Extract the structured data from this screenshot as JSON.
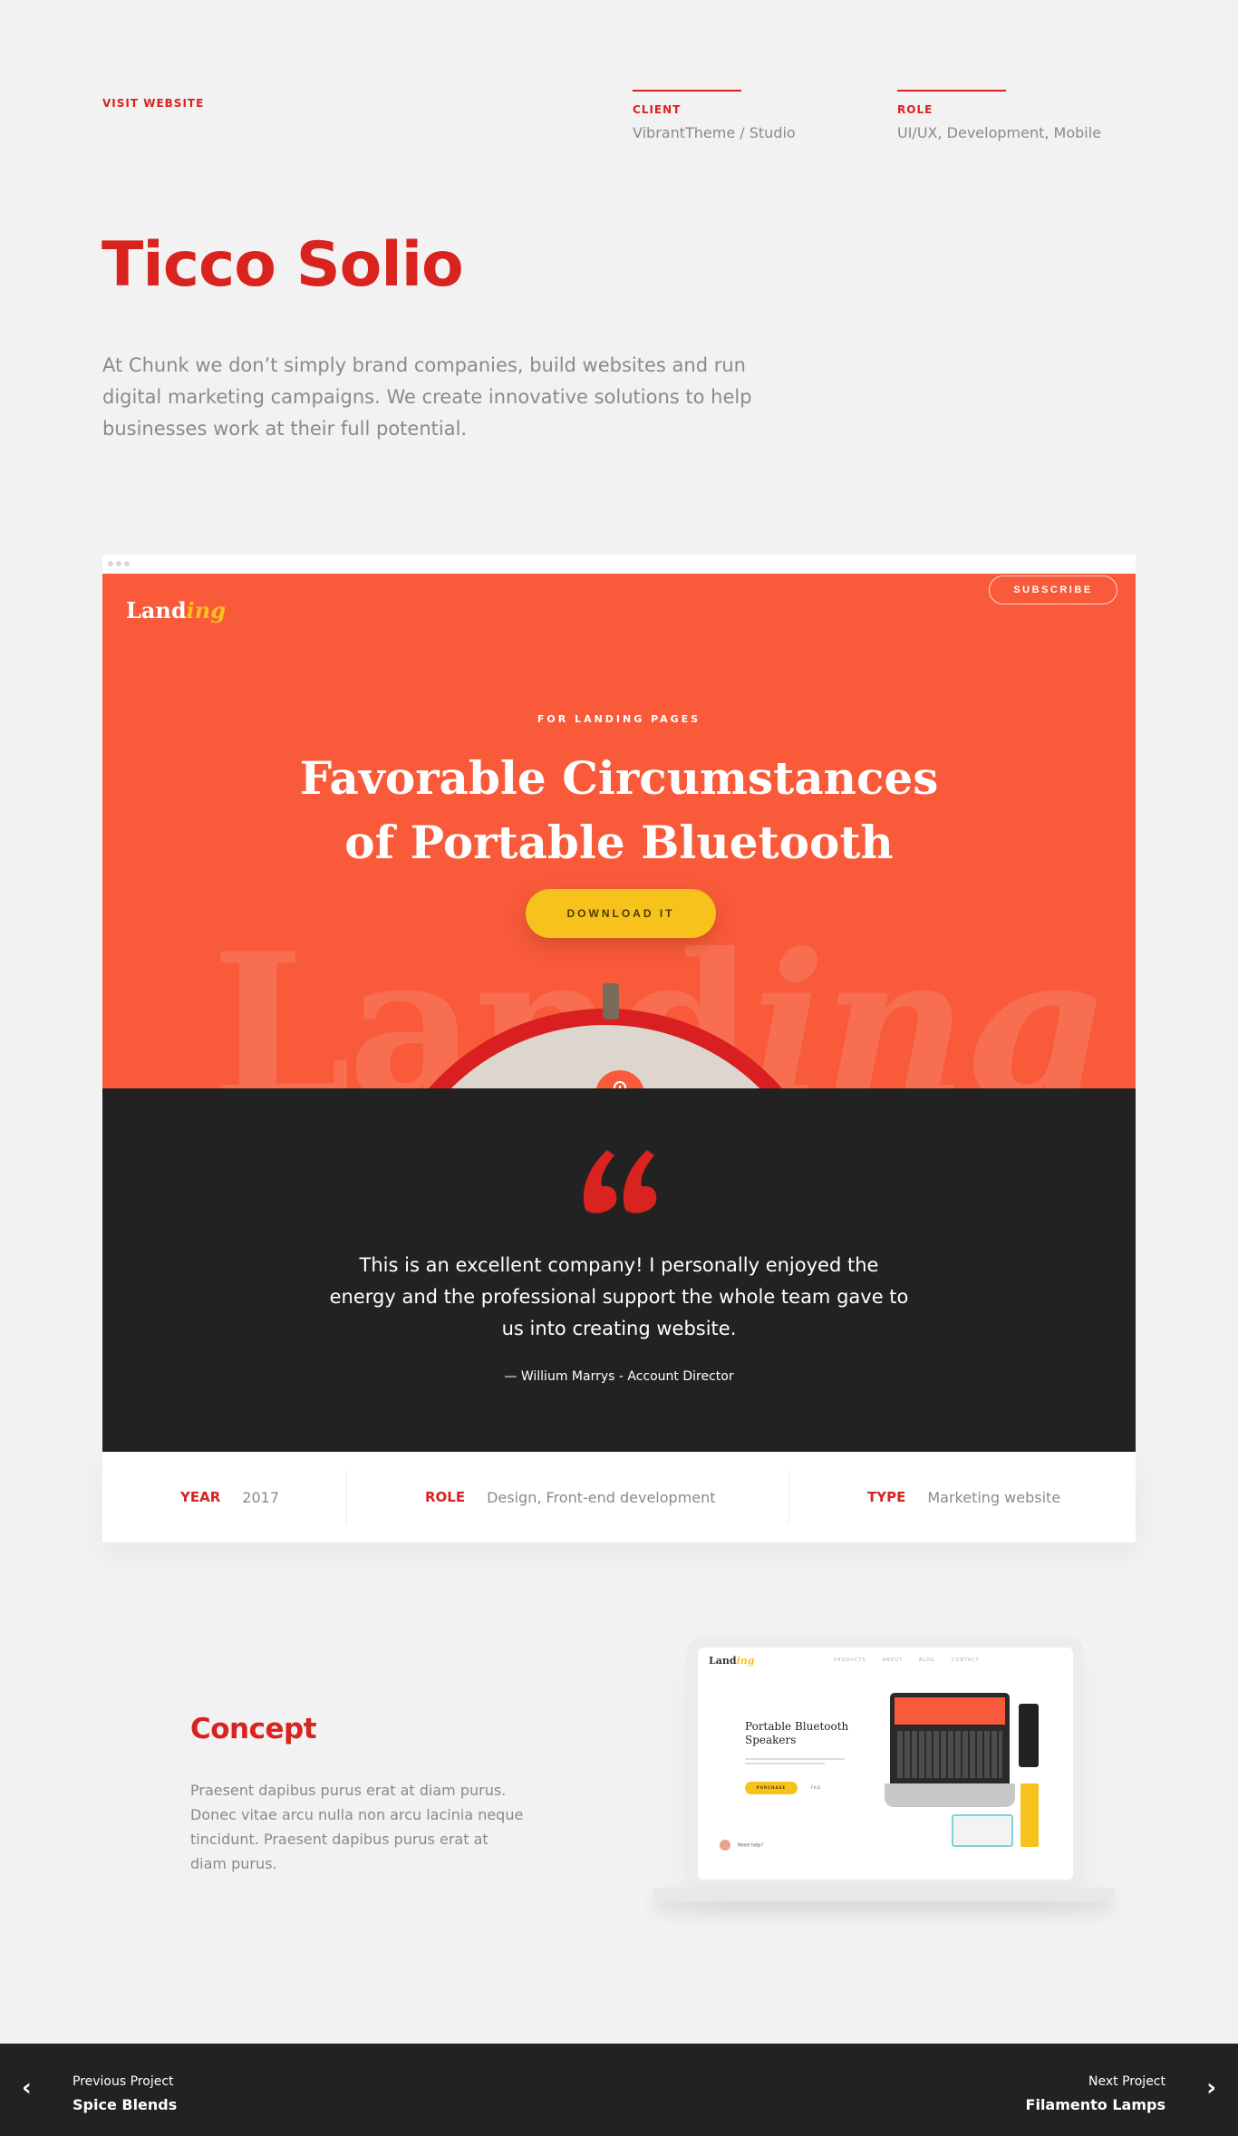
{
  "header": {
    "visit_label": "VISIT WEBSITE",
    "client_label": "CLIENT",
    "client_value": "VibrantTheme / Studio",
    "role_label": "ROLE",
    "role_value": "UI/UX, Development, Mobile"
  },
  "project": {
    "title": "Ticco Solio",
    "intro": "At Chunk we don’t simply brand companies, build websites and run digital marketing campaigns. We create innovative solutions to help businesses work at their full potential."
  },
  "mockup": {
    "logo_main": "Land",
    "logo_accent": "ing",
    "subscribe": "SUBSCRIBE",
    "eyebrow": "FOR LANDING PAGES",
    "headline_line1": "Favorable Circumstances",
    "headline_line2": "of  Portable Bluetooth",
    "download": "DOWNLOAD IT",
    "watermark_main": "Land",
    "watermark_accent": "ing"
  },
  "testimonial": {
    "quote": "This is an excellent company! I personally enjoyed the energy and the professional support the whole team gave to us into creating website.",
    "author": "— Willium Marrys - Account Director"
  },
  "facts": {
    "year_label": "YEAR",
    "year_value": "2017",
    "role_label": "ROLE",
    "role_value": "Design, Front-end development",
    "type_label": "TYPE",
    "type_value": "Marketing website"
  },
  "concept": {
    "title": "Concept",
    "text": "Praesent dapibus purus erat at diam purus. Donec vitae arcu nulla non arcu lacinia neque tincidunt. Praesent dapibus purus erat at diam purus."
  },
  "concept_image": {
    "logo_main": "Land",
    "logo_accent": "ing",
    "nav": [
      "PRODUCTS",
      "ABOUT",
      "BLOG",
      "CONTACT"
    ],
    "headline": "Portable Bluetooth Speakers",
    "button": "PURCHASE",
    "button2": "FAQ",
    "help": "Need help?"
  },
  "footer": {
    "prev_label": "Previous Project",
    "prev_title": "Spice Blends",
    "next_label": "Next Project",
    "next_title": "Filamento Lamps"
  },
  "colors": {
    "accent": "#d8231f",
    "hero": "#f85a3a",
    "button": "#f8c21c",
    "dark": "#222222",
    "background": "#f2f2f2"
  }
}
